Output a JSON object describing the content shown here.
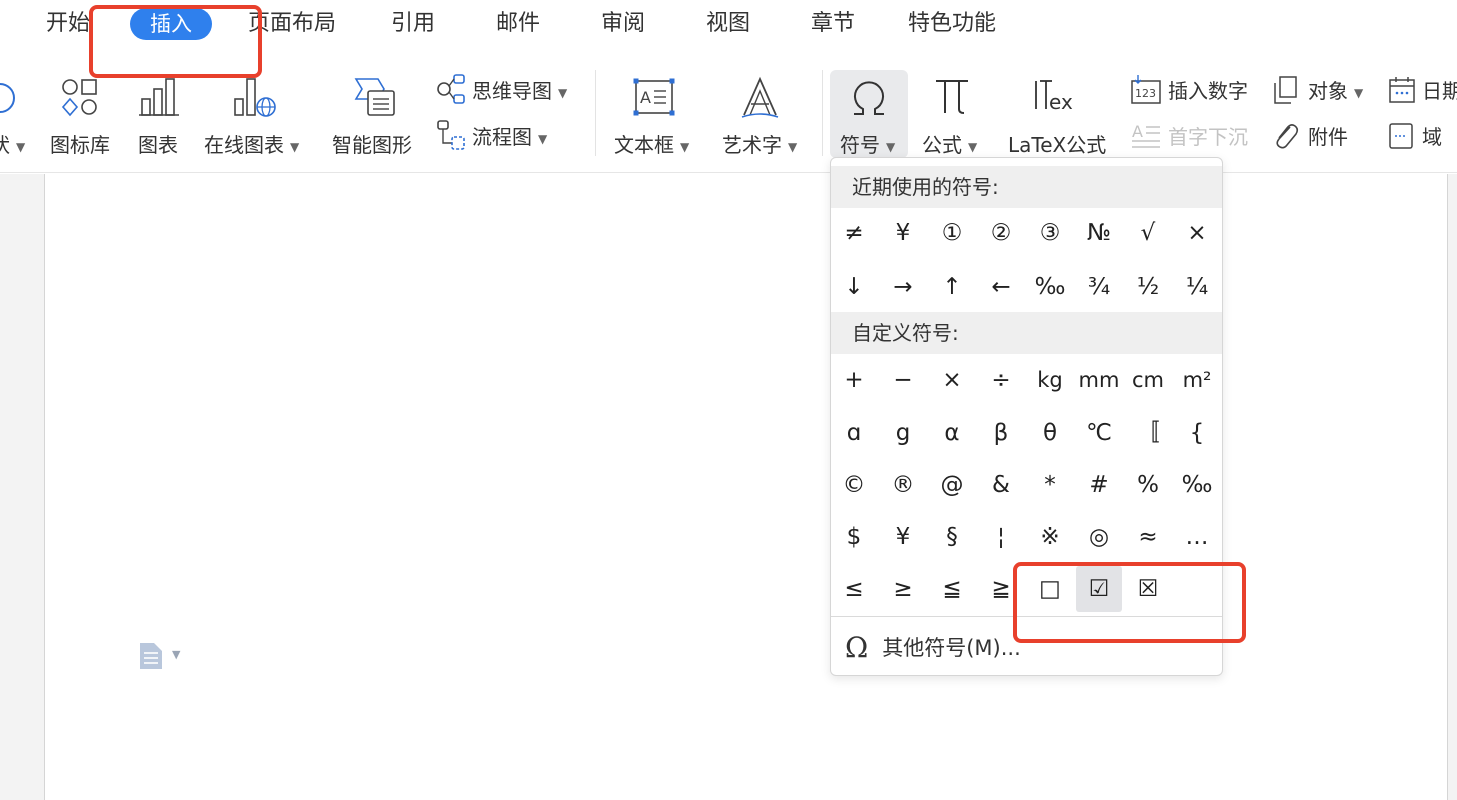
{
  "menu": {
    "tabs": [
      "开始",
      "插入",
      "页面布局",
      "引用",
      "邮件",
      "审阅",
      "视图",
      "章节",
      "特色功能"
    ],
    "active_tab": "插入"
  },
  "ribbon": {
    "partial_left": "状",
    "icon_library": "图标库",
    "chart": "图表",
    "online_chart": "在线图表",
    "smart_graphic": "智能图形",
    "mind_map": "思维导图",
    "flowchart": "流程图",
    "text_box": "文本框",
    "word_art": "艺术字",
    "symbol": "符号",
    "formula": "公式",
    "latex": "LaTeX公式",
    "insert_number": "插入数字",
    "drop_cap": "首字下沉",
    "object": "对象",
    "attachment": "附件",
    "date": "日期",
    "field": "域"
  },
  "symbol_dropdown": {
    "recent_header": "近期使用的符号:",
    "recent_rows": [
      [
        "≠",
        "¥",
        "①",
        "②",
        "③",
        "№",
        "√",
        "×"
      ],
      [
        "↓",
        "→",
        "↑",
        "←",
        "‰",
        "¾",
        "½",
        "¼"
      ]
    ],
    "custom_header": "自定义符号:",
    "custom_rows": [
      [
        "+",
        "−",
        "×",
        "÷",
        "kg",
        "mm",
        "cm",
        "m²"
      ],
      [
        "ɑ",
        "g",
        "α",
        "β",
        "θ",
        "℃",
        "〚",
        "{"
      ],
      [
        "©",
        "®",
        "@",
        "&",
        "*",
        "#",
        "%",
        "‰"
      ],
      [
        "$",
        "¥",
        "§",
        "¦",
        "※",
        "◎",
        "≈",
        "…"
      ],
      [
        "≤",
        "≥",
        "≦",
        "≧",
        "□",
        "☑",
        "☒"
      ]
    ],
    "selected_symbol": "☑",
    "more_symbols": "其他符号(M)..."
  },
  "colors": {
    "accent": "#2f80ed",
    "highlight_box": "#e8402c",
    "icon_blue": "#2f6fd3"
  }
}
